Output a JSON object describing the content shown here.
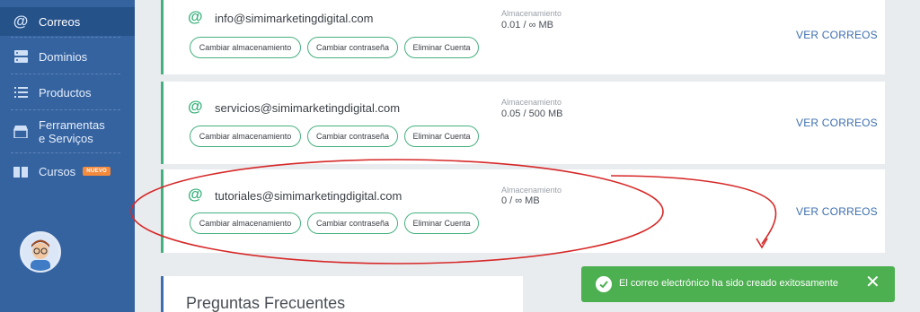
{
  "sidebar": {
    "items": [
      {
        "label": "Correos",
        "icon": "at-icon",
        "active": true
      },
      {
        "label": "Dominios",
        "icon": "server-icon"
      },
      {
        "label": "Productos",
        "icon": "list-icon"
      },
      {
        "label": "Ferramentas e Serviços",
        "icon": "store-icon"
      },
      {
        "label": "Cursos",
        "icon": "book-icon",
        "badge": "NUEVO"
      }
    ]
  },
  "accounts": [
    {
      "email": "info@simimarketingdigital.com",
      "storage_label": "Almacenamiento",
      "storage_value": "0.01 / ∞ MB"
    },
    {
      "email": "servicios@simimarketingdigital.com",
      "storage_label": "Almacenamiento",
      "storage_value": "0.05 / 500 MB"
    },
    {
      "email": "tutoriales@simimarketingdigital.com",
      "storage_label": "Almacenamiento",
      "storage_value": "0 / ∞ MB"
    }
  ],
  "actions": {
    "change_storage": "Cambiar almacenamiento",
    "change_password": "Cambiar contraseña",
    "delete_account": "Eliminar Cuenta",
    "view_mail": "VER CORREOS"
  },
  "faq": {
    "title": "Preguntas Frecuentes"
  },
  "toast": {
    "message": "El correo electrónico ha sido creado exitosamente",
    "close": "✕"
  },
  "colors": {
    "sidebar": "#3563a0",
    "accent_green": "#43b17e",
    "link_blue": "#3d6fb0",
    "toast_green": "#4caf50",
    "annotation_red": "#d62828"
  }
}
